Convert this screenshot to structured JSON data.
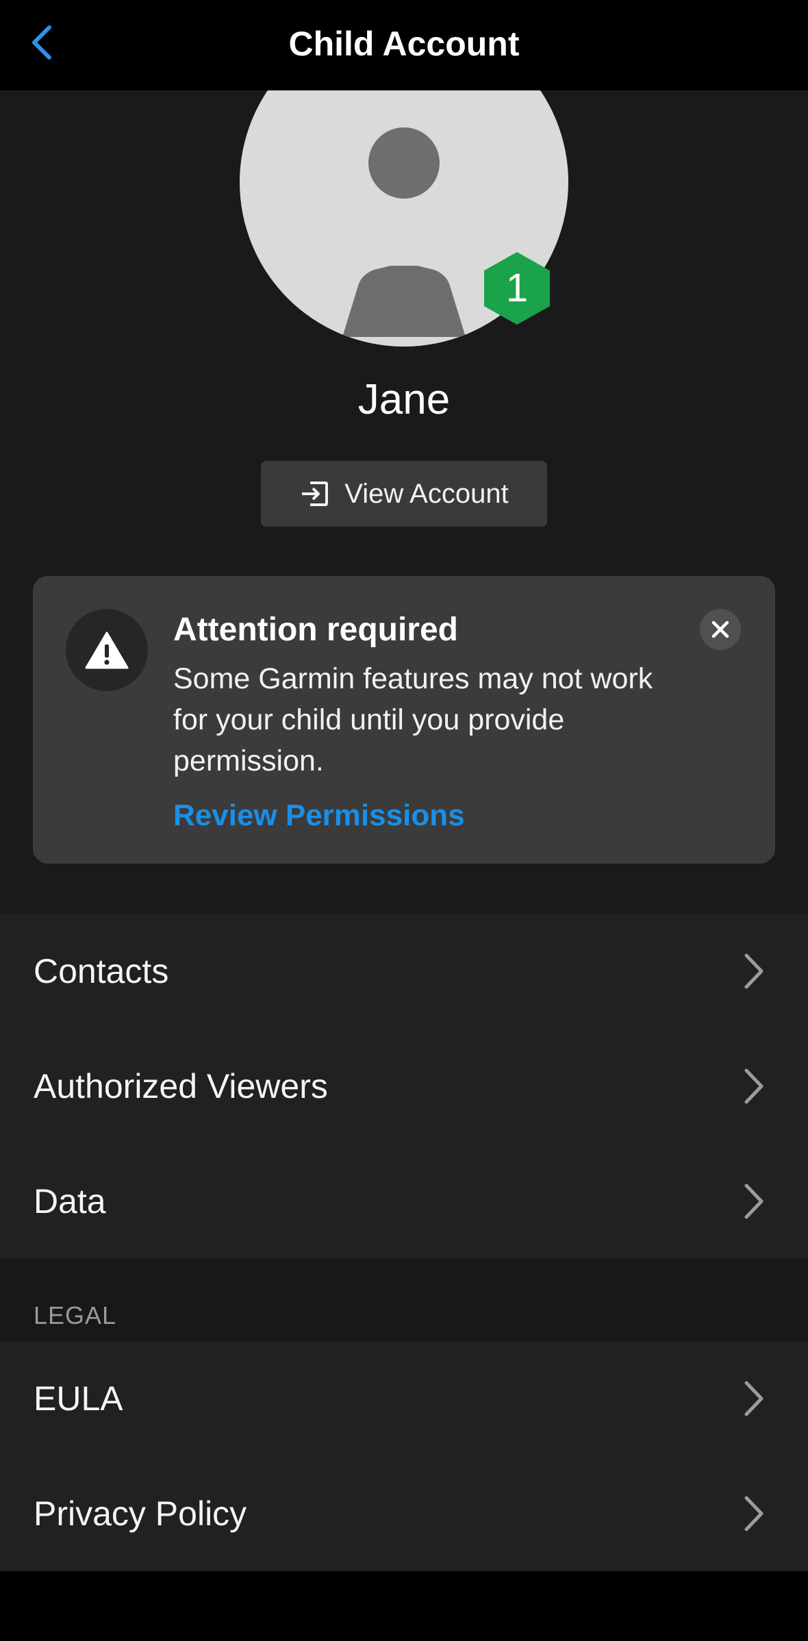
{
  "header": {
    "title": "Child Account",
    "back_icon": "chevron-left-icon",
    "accent_color": "#2f8fe6"
  },
  "profile": {
    "name": "Jane",
    "level_badge": "1",
    "badge_color": "#1aa34a",
    "avatar_icon": "person-silhouette-icon"
  },
  "view_account": {
    "label": "View Account",
    "icon": "sign-in-icon"
  },
  "alert": {
    "icon": "warning-icon",
    "title": "Attention required",
    "body": "Some Garmin features may not work for your child until you provide permission.",
    "link": "Review Permissions",
    "link_color": "#1a8fe6",
    "close_icon": "close-icon"
  },
  "menu": {
    "items": [
      {
        "label": "Contacts"
      },
      {
        "label": "Authorized Viewers"
      },
      {
        "label": "Data"
      }
    ]
  },
  "legal": {
    "section_label": "LEGAL",
    "items": [
      {
        "label": "EULA"
      },
      {
        "label": "Privacy Policy"
      }
    ]
  }
}
